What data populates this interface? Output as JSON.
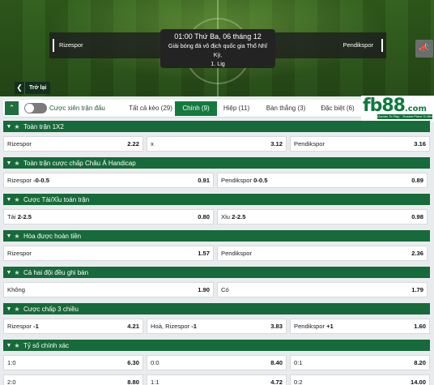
{
  "header": {
    "home_team": "Rizespor",
    "away_team": "Pendikspor",
    "kickoff": "01:00 Thứ Ba, 06 tháng 12",
    "league_line1": "Giải bóng đá vô địch quốc gia Thổ Nhĩ Kỳ,",
    "league_line2": "1. Lig",
    "back_label": "Trở lại"
  },
  "tabs": {
    "toggle_label": "Cược xiên trận đấu",
    "items": [
      {
        "label": "Tất cả kèo (29)"
      },
      {
        "label": "Chính (9)"
      },
      {
        "label": "Hiệp (11)"
      },
      {
        "label": "Bàn thắng (3)"
      },
      {
        "label": "Đặc biệt (6)"
      }
    ],
    "active_index": 1
  },
  "brand": {
    "logo": "fb88",
    "logo_suffix": ".com",
    "tagline": "Games To Play · Trusted Place To Bet",
    "color": "#0e7a3e"
  },
  "markets": [
    {
      "title": "Toàn trận 1X2",
      "rows": [
        [
          {
            "label": "Rizespor",
            "hdp": "",
            "odd": "2.22"
          },
          {
            "label": "x",
            "hdp": "",
            "odd": "3.12"
          },
          {
            "label": "Pendikspor",
            "hdp": "",
            "odd": "3.16"
          }
        ]
      ]
    },
    {
      "title": "Toàn trận cược chấp Châu Á Handicap",
      "rows": [
        [
          {
            "label": "Rizespor",
            "hdp": "-0-0.5",
            "odd": "0.91"
          },
          {
            "label": "Pendikspor",
            "hdp": "0-0.5",
            "odd": "0.89"
          }
        ]
      ]
    },
    {
      "title": "Cược Tài/Xỉu toàn trận",
      "rows": [
        [
          {
            "label": "Tài",
            "hdp": "2-2.5",
            "odd": "0.80"
          },
          {
            "label": "Xỉu",
            "hdp": "2-2.5",
            "odd": "0.98"
          }
        ]
      ]
    },
    {
      "title": "Hòa được hoàn tiền",
      "rows": [
        [
          {
            "label": "Rizespor",
            "hdp": "",
            "odd": "1.57"
          },
          {
            "label": "Pendikspor",
            "hdp": "",
            "odd": "2.36"
          }
        ]
      ]
    },
    {
      "title": "Cả hai đội đều ghi bàn",
      "rows": [
        [
          {
            "label": "Không",
            "hdp": "",
            "odd": "1.90"
          },
          {
            "label": "Có",
            "hdp": "",
            "odd": "1.79"
          }
        ]
      ]
    },
    {
      "title": "Cược chấp 3 chiều",
      "rows": [
        [
          {
            "label": "Rizespor",
            "hdp": "-1",
            "odd": "4.21"
          },
          {
            "label": "Hoà, Rizespor",
            "hdp": "-1",
            "odd": "3.83"
          },
          {
            "label": "Pendikspor",
            "hdp": "+1",
            "odd": "1.60"
          }
        ]
      ]
    },
    {
      "title": "Tỷ số chính xác",
      "rows": [
        [
          {
            "label": "1:0",
            "hdp": "",
            "odd": "6.30"
          },
          {
            "label": "0:0",
            "hdp": "",
            "odd": "8.40"
          },
          {
            "label": "0:1",
            "hdp": "",
            "odd": "8.20"
          }
        ],
        [
          {
            "label": "2:0",
            "hdp": "",
            "odd": "8.80"
          },
          {
            "label": "1:1",
            "hdp": "",
            "odd": "4.72"
          },
          {
            "label": "0:2",
            "hdp": "",
            "odd": "14.00"
          }
        ]
      ]
    }
  ]
}
